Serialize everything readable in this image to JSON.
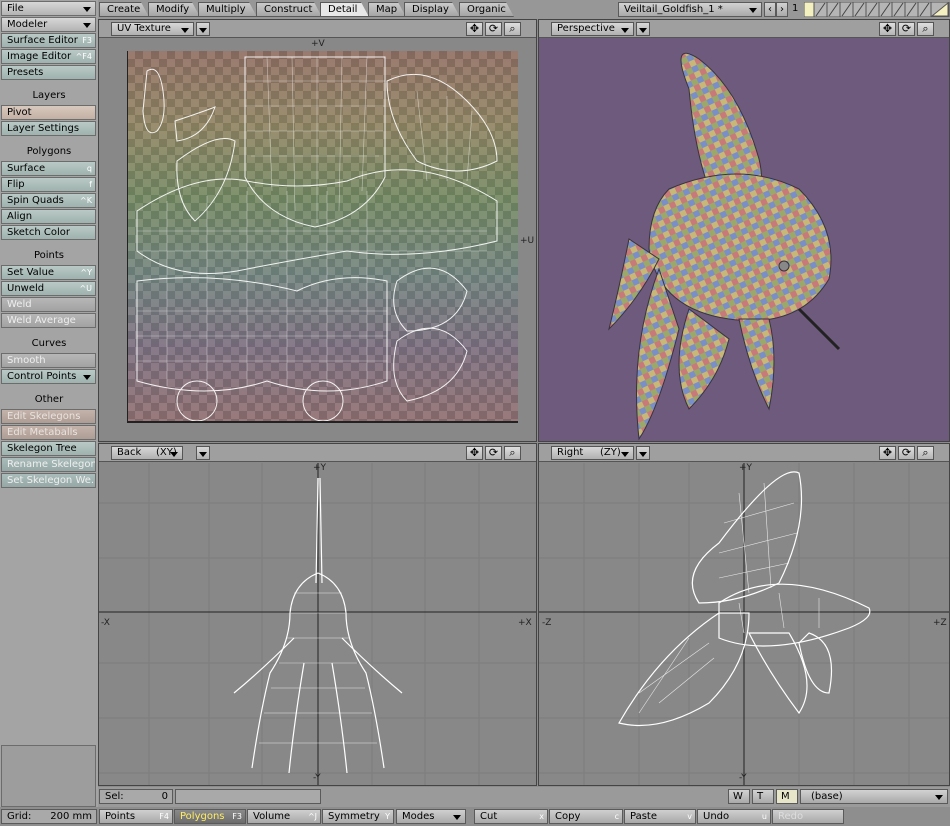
{
  "sidebar": {
    "file": "File",
    "modeler": "Modeler",
    "surface_editor": {
      "label": "Surface Editor",
      "key": "F3"
    },
    "image_editor": {
      "label": "Image Editor",
      "key": "^F4"
    },
    "presets": "Presets",
    "layers_head": "Layers",
    "pivot": "Pivot",
    "layer_settings": "Layer Settings",
    "polygons_head": "Polygons",
    "surface": {
      "label": "Surface",
      "key": "q"
    },
    "flip": {
      "label": "Flip",
      "key": "f"
    },
    "spin_quads": {
      "label": "Spin Quads",
      "key": "^K"
    },
    "align": "Align",
    "sketch_color": "Sketch Color",
    "points_head": "Points",
    "set_value": {
      "label": "Set Value",
      "key": "^Y"
    },
    "unweld": {
      "label": "Unweld",
      "key": "^U"
    },
    "weld": "Weld",
    "weld_average": "Weld Average",
    "curves_head": "Curves",
    "smooth": "Smooth",
    "control_points": "Control Points",
    "other_head": "Other",
    "edit_skelegons": "Edit Skelegons",
    "edit_metaballs": "Edit Metaballs",
    "skelegon_tree": "Skelegon Tree",
    "rename_skelegon": "Rename Skelegon",
    "set_skelegon_weight": "Set Skelegon We..."
  },
  "tabs": [
    "Create",
    "Modify",
    "Multiply",
    "Construct",
    "Detail",
    "Map",
    "Display",
    "Organic"
  ],
  "active_tab": "Detail",
  "object_name": "Veiltail_Goldfish_1 *",
  "layer_number": "1",
  "viewports": {
    "uv": {
      "mode": "UV Texture",
      "top": "+V",
      "right": "+U"
    },
    "perspective": {
      "mode": "Perspective"
    },
    "back": {
      "mode": "Back",
      "axes": "(XY)",
      "top": "+Y",
      "bottom": "-Y",
      "left": "-X",
      "right": "+X"
    },
    "right": {
      "mode": "Right",
      "axes": "(ZY)",
      "top": "+Y",
      "bottom": "-Y",
      "left": "-Z",
      "right": "+Z"
    }
  },
  "status": {
    "sel_label": "Sel:",
    "sel_value": "0",
    "grid_label": "Grid:",
    "grid_value": "200 mm",
    "w": "W",
    "t": "T",
    "m": "M",
    "surface": "(base)"
  },
  "bottom": {
    "points": {
      "label": "Points",
      "key": "F4"
    },
    "polygons": {
      "label": "Polygons",
      "key": "F3"
    },
    "volume": {
      "label": "Volume",
      "key": "^J"
    },
    "symmetry": {
      "label": "Symmetry",
      "key": "Y"
    },
    "modes": "Modes",
    "cut": {
      "label": "Cut",
      "key": "x"
    },
    "copy": {
      "label": "Copy",
      "key": "c"
    },
    "paste": {
      "label": "Paste",
      "key": "v"
    },
    "undo": {
      "label": "Undo",
      "key": "u"
    },
    "redo": "Redo"
  },
  "colors": {
    "perspective_bg": "#6e5a7c",
    "grid_bg": "#888888",
    "active_text": "#ffec60"
  }
}
